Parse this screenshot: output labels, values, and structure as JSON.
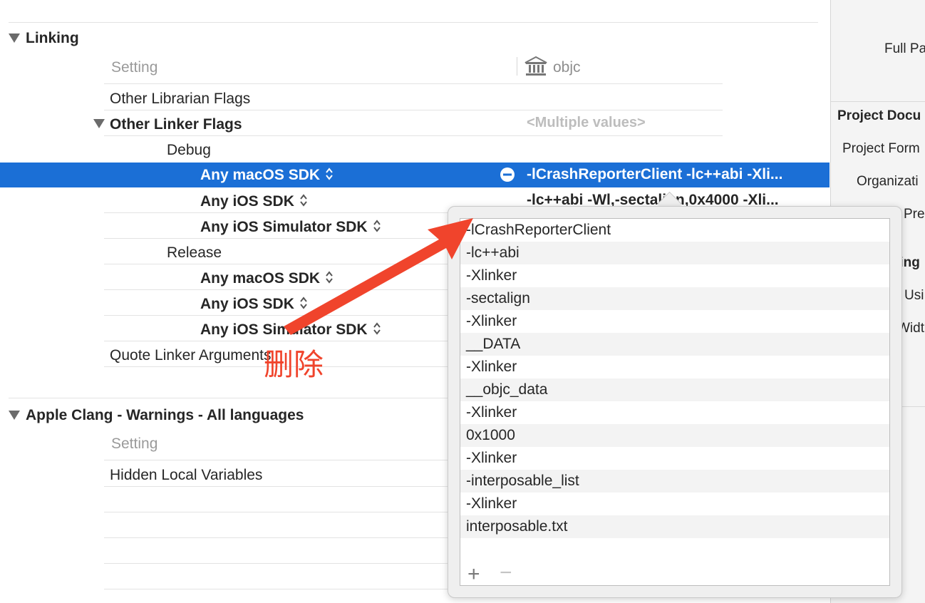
{
  "linking": {
    "title": "Linking",
    "col_setting": "Setting",
    "col_target": "objc",
    "rows": {
      "other_librarian_flags": "Other Librarian Flags",
      "other_linker_flags": "Other Linker Flags",
      "other_linker_flags_value": "<Multiple values>",
      "debug": "Debug",
      "debug_macos": "Any macOS SDK",
      "debug_macos_value": "-lCrashReporterClient -lc++abi -Xli...",
      "debug_ios": "Any iOS SDK",
      "debug_ios_value": "-lc++abi -Wl,-sectalign,0x4000 -Xli...",
      "debug_sim": "Any iOS Simulator SDK",
      "release": "Release",
      "release_macos": "Any macOS SDK",
      "release_ios": "Any iOS SDK",
      "release_sim": "Any iOS Simulator SDK",
      "quote_linker": "Quote Linker Arguments"
    }
  },
  "clang": {
    "title": "Apple Clang - Warnings - All languages",
    "col_setting": "Setting",
    "row1": "Hidden Local Variables"
  },
  "annotation": {
    "text": "删除",
    "color": "#f0442c"
  },
  "popover": {
    "items": [
      "-lCrashReporterClient",
      "-lc++abi",
      "-Xlinker",
      "-sectalign",
      "-Xlinker",
      "__DATA",
      "-Xlinker",
      "__objc_data",
      "-Xlinker",
      "0x1000",
      "-Xlinker",
      "-interposable_list",
      "-Xlinker",
      "interposable.txt"
    ],
    "add_label": "+",
    "remove_label": "−"
  },
  "inspector": {
    "full_path": "Full Pa",
    "project_document": "Project Docu",
    "project_format": "Project Form",
    "organization": "Organizati",
    "prefix": "Pre",
    "settings": "ting",
    "uses": "Usi",
    "width": "Widt"
  },
  "colors": {
    "selection": "#1b6fd6",
    "background": "#ffffff"
  }
}
